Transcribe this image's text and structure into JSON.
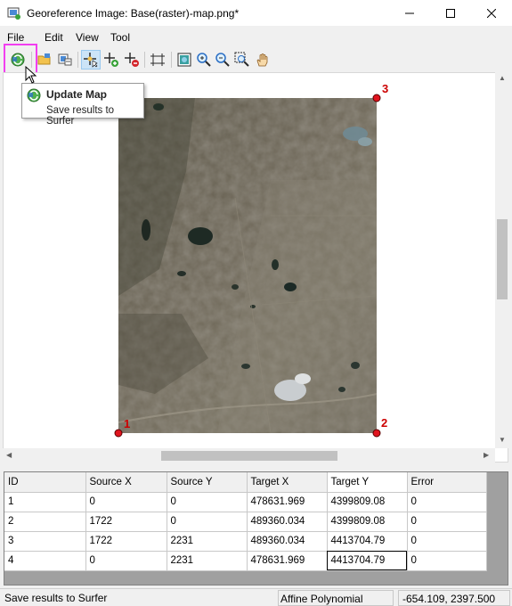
{
  "window": {
    "title": "Georeference Image: Base(raster)-map.png*",
    "minimize_icon": "minimize-icon",
    "maximize_icon": "maximize-icon",
    "close_icon": "close-icon"
  },
  "menu": [
    "File",
    "Edit",
    "View",
    "Tool"
  ],
  "toolbar": {
    "buttons": [
      {
        "name": "update-map",
        "icon": "update-map-icon"
      },
      {
        "name": "open-image",
        "icon": "open-folder-icon"
      },
      {
        "name": "load-points",
        "icon": "load-points-icon"
      },
      {
        "name": "select-point",
        "icon": "select-point-icon",
        "active": true
      },
      {
        "name": "add-point",
        "icon": "add-point-icon"
      },
      {
        "name": "delete-point",
        "icon": "delete-point-icon"
      },
      {
        "name": "move-points",
        "icon": "move-points-icon"
      },
      {
        "name": "zoom-fit",
        "icon": "zoom-fit-icon"
      },
      {
        "name": "zoom-in",
        "icon": "zoom-in-icon"
      },
      {
        "name": "zoom-out",
        "icon": "zoom-out-icon"
      },
      {
        "name": "zoom-rect",
        "icon": "zoom-rect-icon"
      },
      {
        "name": "pan",
        "icon": "hand-icon"
      }
    ]
  },
  "tooltip": {
    "title": "Update Map",
    "description": "Save results to Surfer"
  },
  "map": {
    "control_points": [
      "1",
      "2",
      "3"
    ],
    "marker_color": "#e0141e",
    "label_color": "#cc0000"
  },
  "grid": {
    "columns": [
      "ID",
      "Source X",
      "Source Y",
      "Target X",
      "Target Y",
      "Error"
    ],
    "rows": [
      [
        "1",
        "0",
        "0",
        "478631.969",
        "4399809.08",
        "0"
      ],
      [
        "2",
        "1722",
        "0",
        "489360.034",
        "4399809.08",
        "0"
      ],
      [
        "3",
        "1722",
        "2231",
        "489360.034",
        "4413704.79",
        "0"
      ],
      [
        "4",
        "0",
        "2231",
        "478631.969",
        "4413704.79",
        "0"
      ]
    ]
  },
  "status": {
    "message": "Save results to Surfer",
    "method": "Affine Polynomial",
    "coordinates": "-654.109, 2397.500"
  }
}
